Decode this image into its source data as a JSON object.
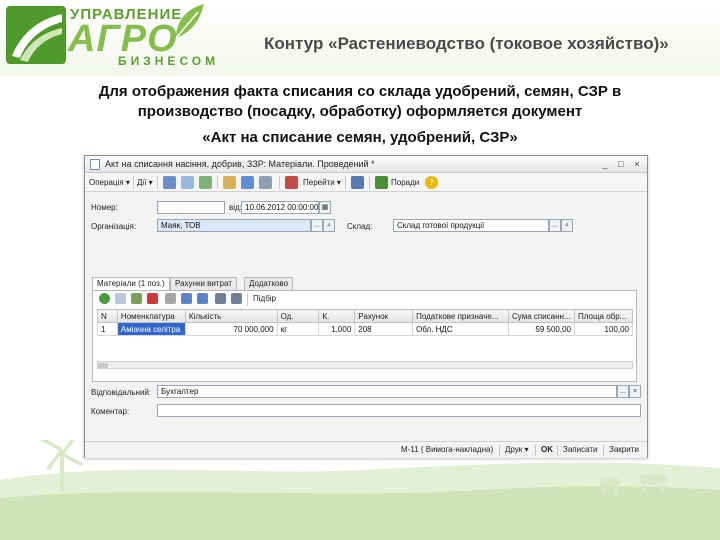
{
  "header": {
    "logo_top": "УПРАВЛЕНИЕ",
    "logo_main": "АГРО",
    "logo_bottom": "БИЗНЕСОМ",
    "title": "Контур «Растениеводство (токовое хозяйство)»"
  },
  "description": {
    "line1": "Для отображения факта списания со склада удобрений, семян, СЗР в",
    "line2": "производство (посадку, обработку) оформляется документ",
    "line3": "«Акт на списание семян, удобрений, СЗР»"
  },
  "window": {
    "title": "Акт на списання насіння, добрив, ЗЗР: Матеріали. Проведений *",
    "controls": [
      "_",
      "□",
      "×"
    ],
    "toolbar": {
      "operations": "Операція ▾",
      "actions": "Дії ▾",
      "goto": "Перейти ▾",
      "hints": "Поради"
    },
    "form": {
      "number_label": "Номер:",
      "number_value": "",
      "date_label": "від:",
      "date_value": "10.06.2012 00:00:00",
      "org_label": "Організація:",
      "org_value": "Маяк, ТОВ",
      "warehouse_label": "Склад:",
      "warehouse_value": "Склад готової продукції",
      "responsible_label": "Відповідальний:",
      "responsible_value": "Бухгалтер",
      "comment_label": "Коментар:",
      "comment_value": ""
    },
    "tabs": [
      {
        "label": "Матеріали (1 поз.)",
        "active": true
      },
      {
        "label": "Рахунки витрат",
        "active": false
      },
      {
        "label": "Додатково",
        "active": false
      }
    ],
    "grid_toolbar": {
      "selection": "Підбір"
    },
    "grid": {
      "columns": [
        "N",
        "Номенклатура",
        "Кількість",
        "Од.",
        "К.",
        "Рахунок",
        "Податкове призначе...",
        "Сума списанн...",
        "Площа обр..."
      ],
      "rows": [
        [
          "1",
          "Аміачна селітра",
          "70 000,000",
          "кг",
          "1,000",
          "208",
          "Обл. НДС",
          "59 500,00",
          "100,00"
        ]
      ]
    },
    "bottom": {
      "print_form": "М-11 ( Вимога-накладна)",
      "print": "Друк ▾",
      "ok": "OK",
      "save": "Записати",
      "close": "Закрити"
    }
  },
  "colors": {
    "brand_green": "#5c9f33",
    "brand_light_green": "#86bd4b",
    "selection_blue": "#3366cc"
  }
}
